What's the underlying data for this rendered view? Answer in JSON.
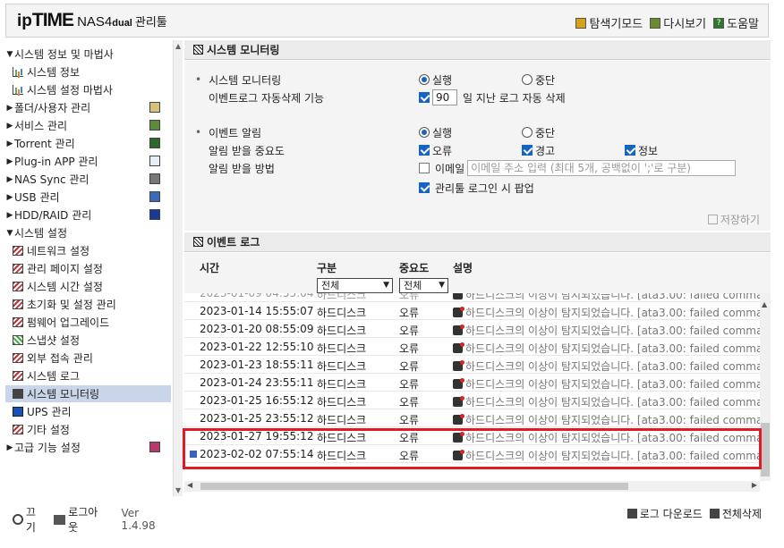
{
  "header": {
    "logo_ip": "ip",
    "logo_time": "TIME",
    "logo_model": "NAS4",
    "logo_dual": "dual",
    "logo_admin": "관리툴",
    "links": [
      {
        "label": "탐색기모드",
        "icon": "explorer-icon"
      },
      {
        "label": "다시보기",
        "icon": "reload-icon"
      },
      {
        "label": "도움말",
        "icon": "help-icon"
      }
    ]
  },
  "sidebar": {
    "items": [
      {
        "label": "시스템 정보 및 마법사",
        "type": "group",
        "expanded": true
      },
      {
        "label": "시스템 정보",
        "type": "child",
        "icon": "chart-icon"
      },
      {
        "label": "시스템 설정 마법사",
        "type": "child",
        "icon": "chart-icon"
      },
      {
        "label": "폴더/사용자 관리",
        "type": "group",
        "expanded": false
      },
      {
        "label": "서비스 관리",
        "type": "group",
        "expanded": false
      },
      {
        "label": "Torrent 관리",
        "type": "group",
        "expanded": false
      },
      {
        "label": "Plug-in APP 관리",
        "type": "group",
        "expanded": false
      },
      {
        "label": "NAS Sync 관리",
        "type": "group",
        "expanded": false
      },
      {
        "label": "USB 관리",
        "type": "group",
        "expanded": false
      },
      {
        "label": "HDD/RAID 관리",
        "type": "group",
        "expanded": false
      },
      {
        "label": "시스템 설정",
        "type": "group",
        "expanded": true
      },
      {
        "label": "네트워크 설정",
        "type": "child"
      },
      {
        "label": "관리 페이지 설정",
        "type": "child"
      },
      {
        "label": "시스템 시간 설정",
        "type": "child"
      },
      {
        "label": "초기화 및 설정 관리",
        "type": "child"
      },
      {
        "label": "펌웨어 업그레이드",
        "type": "child"
      },
      {
        "label": "스냅샷 설정",
        "type": "child"
      },
      {
        "label": "외부 접속 관리",
        "type": "child"
      },
      {
        "label": "시스템 로그",
        "type": "child"
      },
      {
        "label": "시스템 모니터링",
        "type": "child",
        "selected": true
      },
      {
        "label": "UPS 관리",
        "type": "child"
      },
      {
        "label": "기타 설정",
        "type": "child"
      },
      {
        "label": "고급 기능 설정",
        "type": "group",
        "expanded": false
      }
    ],
    "footer": {
      "off_label": "끄기",
      "logout_label": "로그아웃",
      "version": "Ver 1.4.98"
    }
  },
  "monitor": {
    "title": "시스템 모니터링",
    "monitoring_label": "시스템 모니터링",
    "run_label": "실행",
    "stop_label": "중단",
    "monitoring_state": "run",
    "autodelete_label": "이벤트로그 자동삭제 기능",
    "autodelete_checked": true,
    "autodelete_days": "90",
    "autodelete_suffix": "일 지난 로그 자동 삭제",
    "alert_label": "이벤트 알림",
    "alert_state": "run",
    "severity_label": "알림 받을 중요도",
    "severity_error": "오류",
    "severity_warning": "경고",
    "severity_info": "정보",
    "method_label": "알림 받을 방법",
    "email_label": "이메일",
    "email_checked": false,
    "email_placeholder": "이메일 주소 입력 (최대 5개, 공백없이 ';'로 구분)",
    "popup_label": "관리툴 로그인 시 팝업",
    "popup_checked": true,
    "save_label": "저장하기"
  },
  "eventlog": {
    "title": "이벤트 로그",
    "columns": {
      "time": "시간",
      "category": "구분",
      "severity": "중요도",
      "message": "설명"
    },
    "category_filter": "전체",
    "severity_filter": "전체",
    "rows": [
      {
        "time": "2023-01-14 15:55:07",
        "category": "하드디스크",
        "severity": "오류",
        "message": "하드디스크의 이상이 탐지되었습니다. [ata3.00: failed comma"
      },
      {
        "time": "2023-01-20 08:55:09",
        "category": "하드디스크",
        "severity": "오류",
        "message": "하드디스크의 이상이 탐지되었습니다. [ata3.00: failed comma"
      },
      {
        "time": "2023-01-22 12:55:10",
        "category": "하드디스크",
        "severity": "오류",
        "message": "하드디스크의 이상이 탐지되었습니다. [ata3.00: failed comma"
      },
      {
        "time": "2023-01-23 18:55:11",
        "category": "하드디스크",
        "severity": "오류",
        "message": "하드디스크의 이상이 탐지되었습니다. [ata3.00: failed comma"
      },
      {
        "time": "2023-01-24 23:55:11",
        "category": "하드디스크",
        "severity": "오류",
        "message": "하드디스크의 이상이 탐지되었습니다. [ata3.00: failed comma"
      },
      {
        "time": "2023-01-25 16:55:12",
        "category": "하드디스크",
        "severity": "오류",
        "message": "하드디스크의 이상이 탐지되었습니다. [ata3.00: failed comma"
      },
      {
        "time": "2023-01-25 23:55:12",
        "category": "하드디스크",
        "severity": "오류",
        "message": "하드디스크의 이상이 탐지되었습니다. [ata3.00: failed comma"
      },
      {
        "time": "2023-01-27 19:55:12",
        "category": "하드디스크",
        "severity": "오류",
        "message": "하드디스크의 이상이 탐지되었습니다. [ata3.00: failed comma"
      },
      {
        "time": "2023-02-02 07:55:14",
        "category": "하드디스크",
        "severity": "오류",
        "message": "하드디스크의 이상이 탐지되었습니다. [ata3.00: failed comma",
        "new": true
      }
    ],
    "download_label": "로그 다운로드",
    "delete_all_label": "전체삭제"
  },
  "colors": {
    "accent": "#1763c2",
    "highlight": "#e01b24",
    "selected": "#c9d6ea"
  }
}
